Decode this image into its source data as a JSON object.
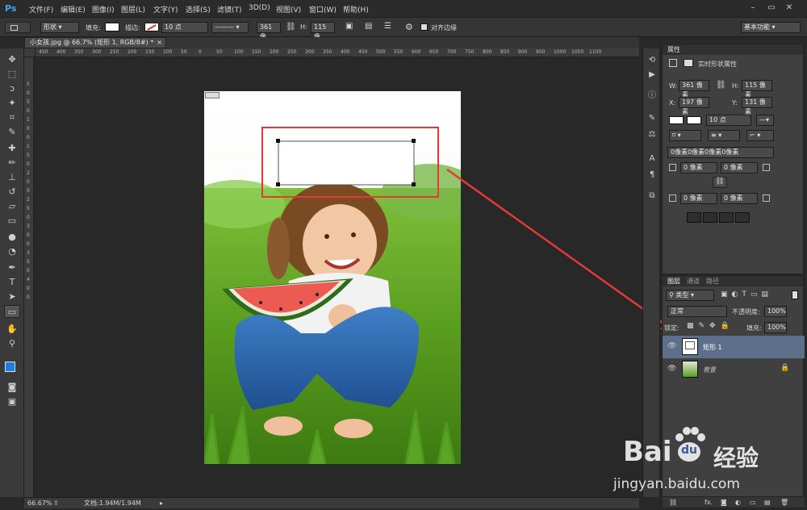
{
  "app": {
    "logo": "Ps"
  },
  "menu": [
    "文件(F)",
    "编辑(E)",
    "图像(I)",
    "图层(L)",
    "文字(Y)",
    "选择(S)",
    "滤镜(T)",
    "3D(D)",
    "视图(V)",
    "窗口(W)",
    "帮助(H)"
  ],
  "window_controls": [
    "–",
    "▭",
    "✕"
  ],
  "options": {
    "mode": "形状",
    "fill_label": "填充:",
    "stroke_label": "描边:",
    "stroke_width": "10 点",
    "w_label": "W:",
    "w_value": "361 像",
    "h_label": "H:",
    "h_value": "115 像",
    "align_edges": "对齐边缘",
    "workspace": "基本功能"
  },
  "document": {
    "tab_title": "小女孩.jpg @ 66.7% (矩形 1, RGB/8#) *",
    "close": "×",
    "zoom": "66.67%",
    "doc_size": "文档:1.94M/1.94M"
  },
  "rulers": {
    "h": [
      "450",
      "400",
      "350",
      "300",
      "250",
      "200",
      "150",
      "100",
      "50",
      "0",
      "50",
      "100",
      "150",
      "200",
      "250",
      "300",
      "350",
      "400",
      "450",
      "500",
      "550",
      "600",
      "650",
      "700",
      "750",
      "800",
      "850",
      "900",
      "950",
      "1000",
      "1050",
      "1100"
    ],
    "v": [
      "5",
      "0",
      "5",
      "0",
      "1",
      "0",
      "0",
      "1",
      "5",
      "0",
      "2",
      "0",
      "0",
      "2",
      "5",
      "0",
      "3",
      "0",
      "0",
      "3",
      "5",
      "0",
      "4",
      "0",
      "0"
    ]
  },
  "properties": {
    "title": "属性",
    "section": "实时形状属性",
    "w_label": "W:",
    "w_value": "361 像素",
    "h_label": "H:",
    "h_value": "115 像素",
    "x_label": "X:",
    "x_value": "197 像素",
    "y_label": "Y:",
    "y_value": "131 像素",
    "stroke_pt": "10 点",
    "corner_all": "0像素0像素0像素0像素",
    "corner_tl": "0 像素",
    "corner_tr": "0 像素",
    "corner_bl": "0 像素",
    "corner_br": "0 像素"
  },
  "layers": {
    "tabs": [
      "图层",
      "通道",
      "路径"
    ],
    "filter": "类型",
    "blend": "正常",
    "opacity_label": "不透明度:",
    "opacity": "100%",
    "lock_label": "锁定:",
    "fill_label": "填充:",
    "fill": "100%",
    "items": [
      {
        "name": "矩形 1",
        "selected": true
      },
      {
        "name": "背景",
        "selected": false
      }
    ],
    "footer_fx": "fx."
  },
  "watermark": {
    "brand": "Bai",
    "brand2": "du",
    "text": "经验",
    "url": "jingyan.baidu.com"
  },
  "colors": {
    "accent": "#3aa7ff",
    "annotation": "#e53935",
    "selected_layer": "#5e6f8c"
  }
}
